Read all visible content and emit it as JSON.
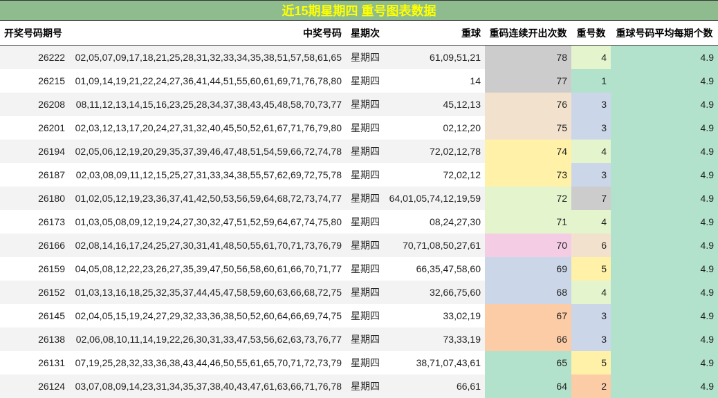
{
  "title": "近15期星期四 重号图表数据",
  "headers": {
    "issue": "开奖号码期号",
    "numbers": "中奖号码",
    "weekday": "星期次",
    "repeat": "重球",
    "consecutive": "重码连续开出次数",
    "count": "重号数",
    "average": "重球号码平均每期个数"
  },
  "palette": {
    "gray": "#cccccc",
    "beige": "#f2e2cd",
    "yellow": "#fff2a8",
    "lightgreen": "#e4f4cd",
    "pink": "#f4cce4",
    "blue": "#cbd6e8",
    "orange": "#fccca6",
    "mint": "#b2e2cc"
  },
  "rows": [
    {
      "issue": "26222",
      "numbers": "02,05,07,09,17,18,21,25,28,31,32,33,34,35,38,51,57,58,61,65",
      "weekday": "星期四",
      "repeat": "61,09,51,21",
      "consecutive": "78",
      "count": "4",
      "average": "4.9",
      "consecutive_color": "#cccccc",
      "count_color": "#e4f4cd"
    },
    {
      "issue": "26215",
      "numbers": "01,09,14,19,21,22,24,27,36,41,44,51,55,60,61,69,71,76,78,80",
      "weekday": "星期四",
      "repeat": "14",
      "consecutive": "77",
      "count": "1",
      "average": "4.9",
      "consecutive_color": "#cccccc",
      "count_color": "#b2e2cc"
    },
    {
      "issue": "26208",
      "numbers": "08,11,12,13,14,15,16,23,25,28,34,37,38,43,45,48,58,70,73,77",
      "weekday": "星期四",
      "repeat": "45,12,13",
      "consecutive": "76",
      "count": "3",
      "average": "4.9",
      "consecutive_color": "#f2e2cd",
      "count_color": "#cbd6e8"
    },
    {
      "issue": "26201",
      "numbers": "02,03,12,13,17,20,24,27,31,32,40,45,50,52,61,67,71,76,79,80",
      "weekday": "星期四",
      "repeat": "02,12,20",
      "consecutive": "75",
      "count": "3",
      "average": "4.9",
      "consecutive_color": "#f2e2cd",
      "count_color": "#cbd6e8"
    },
    {
      "issue": "26194",
      "numbers": "02,05,06,12,19,20,29,35,37,39,46,47,48,51,54,59,66,72,74,78",
      "weekday": "星期四",
      "repeat": "72,02,12,78",
      "consecutive": "74",
      "count": "4",
      "average": "4.9",
      "consecutive_color": "#fff2a8",
      "count_color": "#e4f4cd"
    },
    {
      "issue": "26187",
      "numbers": "02,03,08,09,11,12,15,25,27,31,33,34,38,55,57,62,69,72,75,78",
      "weekday": "星期四",
      "repeat": "72,02,12",
      "consecutive": "73",
      "count": "3",
      "average": "4.9",
      "consecutive_color": "#fff2a8",
      "count_color": "#cbd6e8"
    },
    {
      "issue": "26180",
      "numbers": "01,02,05,12,19,23,36,37,41,42,50,53,56,59,64,68,72,73,74,77",
      "weekday": "星期四",
      "repeat": "64,01,05,74,12,19,59",
      "consecutive": "72",
      "count": "7",
      "average": "4.9",
      "consecutive_color": "#e4f4cd",
      "count_color": "#cccccc"
    },
    {
      "issue": "26173",
      "numbers": "01,03,05,08,09,12,19,24,27,30,32,47,51,52,59,64,67,74,75,80",
      "weekday": "星期四",
      "repeat": "08,24,27,30",
      "consecutive": "71",
      "count": "4",
      "average": "4.9",
      "consecutive_color": "#e4f4cd",
      "count_color": "#e4f4cd"
    },
    {
      "issue": "26166",
      "numbers": "02,08,14,16,17,24,25,27,30,31,41,48,50,55,61,70,71,73,76,79",
      "weekday": "星期四",
      "repeat": "70,71,08,50,27,61",
      "consecutive": "70",
      "count": "6",
      "average": "4.9",
      "consecutive_color": "#f4cce4",
      "count_color": "#f2e2cd"
    },
    {
      "issue": "26159",
      "numbers": "04,05,08,12,22,23,26,27,35,39,47,50,56,58,60,61,66,70,71,77",
      "weekday": "星期四",
      "repeat": "66,35,47,58,60",
      "consecutive": "69",
      "count": "5",
      "average": "4.9",
      "consecutive_color": "#cbd6e8",
      "count_color": "#fff2a8"
    },
    {
      "issue": "26152",
      "numbers": "01,03,13,16,18,25,32,35,37,44,45,47,58,59,60,63,66,68,72,75",
      "weekday": "星期四",
      "repeat": "32,66,75,60",
      "consecutive": "68",
      "count": "4",
      "average": "4.9",
      "consecutive_color": "#cbd6e8",
      "count_color": "#e4f4cd"
    },
    {
      "issue": "26145",
      "numbers": "02,04,05,15,19,24,27,29,32,33,36,38,50,52,60,64,66,69,74,75",
      "weekday": "星期四",
      "repeat": "33,02,19",
      "consecutive": "67",
      "count": "3",
      "average": "4.9",
      "consecutive_color": "#fccca6",
      "count_color": "#cbd6e8"
    },
    {
      "issue": "26138",
      "numbers": "02,06,08,10,11,14,19,22,26,30,31,33,47,53,56,62,63,73,76,77",
      "weekday": "星期四",
      "repeat": "73,33,19",
      "consecutive": "66",
      "count": "3",
      "average": "4.9",
      "consecutive_color": "#fccca6",
      "count_color": "#cbd6e8"
    },
    {
      "issue": "26131",
      "numbers": "07,19,25,28,32,33,36,38,43,44,46,50,55,61,65,70,71,72,73,79",
      "weekday": "星期四",
      "repeat": "38,71,07,43,61",
      "consecutive": "65",
      "count": "5",
      "average": "4.9",
      "consecutive_color": "#b2e2cc",
      "count_color": "#fff2a8"
    },
    {
      "issue": "26124",
      "numbers": "03,07,08,09,14,23,31,34,35,37,38,40,43,47,61,63,66,71,76,78",
      "weekday": "星期四",
      "repeat": "66,61",
      "consecutive": "64",
      "count": "2",
      "average": "4.9",
      "consecutive_color": "#b2e2cc",
      "count_color": "#fccca6"
    }
  ],
  "average_color": "#b2e2cc"
}
